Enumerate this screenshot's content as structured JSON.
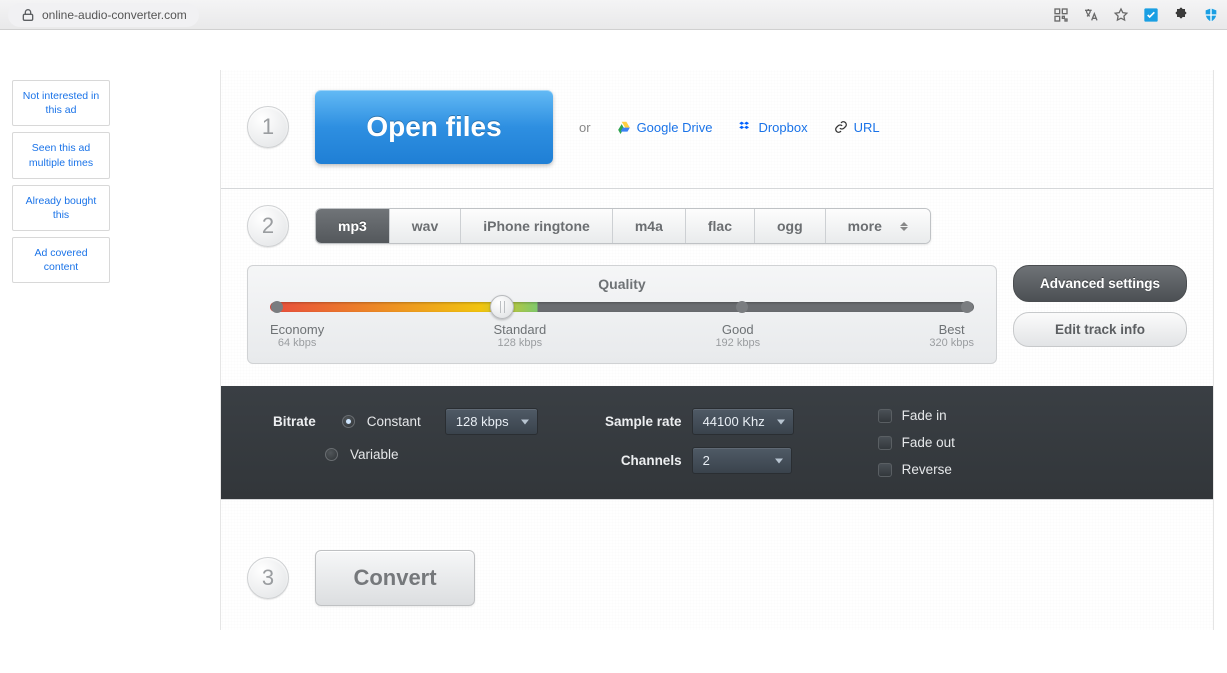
{
  "browser": {
    "url": "online-audio-converter.com"
  },
  "ads": {
    "choices": [
      "Not interested in this ad",
      "Seen this ad multiple times",
      "Already bought this",
      "Ad covered content"
    ]
  },
  "step1": {
    "num": "1",
    "open_label": "Open files",
    "or": "or",
    "gdrive": "Google Drive",
    "dropbox": "Dropbox",
    "url": "URL"
  },
  "step2": {
    "num": "2",
    "formats": [
      "mp3",
      "wav",
      "iPhone ringtone",
      "m4a",
      "flac",
      "ogg",
      "more"
    ],
    "active_format": "mp3",
    "quality_title": "Quality",
    "marks": [
      {
        "name": "Economy",
        "rate": "64 kbps"
      },
      {
        "name": "Standard",
        "rate": "128 kbps"
      },
      {
        "name": "Good",
        "rate": "192 kbps"
      },
      {
        "name": "Best",
        "rate": "320 kbps"
      }
    ],
    "advanced_label": "Advanced settings",
    "edit_label": "Edit track info"
  },
  "advanced": {
    "bitrate_label": "Bitrate",
    "bitrate_mode_constant": "Constant",
    "bitrate_mode_variable": "Variable",
    "bitrate_value": "128 kbps",
    "samplerate_label": "Sample rate",
    "samplerate_value": "44100 Khz",
    "channels_label": "Channels",
    "channels_value": "2",
    "fadein": "Fade in",
    "fadeout": "Fade out",
    "reverse": "Reverse"
  },
  "step3": {
    "num": "3",
    "convert_label": "Convert"
  }
}
